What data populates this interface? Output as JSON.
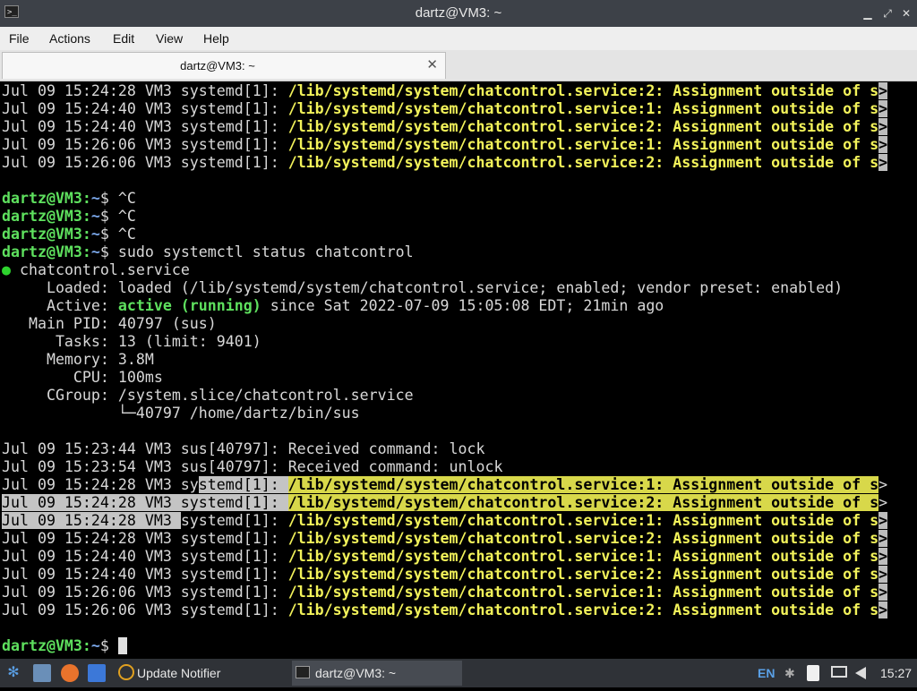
{
  "window": {
    "title": "dartz@VM3: ~",
    "controls": {
      "minimize": "▁",
      "maximize": "⤢",
      "close": "✕"
    }
  },
  "menu": [
    "File",
    "Actions",
    "Edit",
    "View",
    "Help"
  ],
  "tab": {
    "label": "dartz@VM3: ~",
    "close": "✕"
  },
  "terminal": {
    "lines": [
      [
        {
          "t": "Jul 09 15:24:28 VM3 systemd[1]: "
        },
        {
          "t": "/lib/systemd/system/chatcontrol.service:2: Assignment outside of s",
          "c": "yellow"
        },
        {
          "t": ">",
          "c": "trunc"
        }
      ],
      [
        {
          "t": "Jul 09 15:24:40 VM3 systemd[1]: "
        },
        {
          "t": "/lib/systemd/system/chatcontrol.service:1: Assignment outside of s",
          "c": "yellow"
        },
        {
          "t": ">",
          "c": "trunc"
        }
      ],
      [
        {
          "t": "Jul 09 15:24:40 VM3 systemd[1]: "
        },
        {
          "t": "/lib/systemd/system/chatcontrol.service:2: Assignment outside of s",
          "c": "yellow"
        },
        {
          "t": ">",
          "c": "trunc"
        }
      ],
      [
        {
          "t": "Jul 09 15:26:06 VM3 systemd[1]: "
        },
        {
          "t": "/lib/systemd/system/chatcontrol.service:1: Assignment outside of s",
          "c": "yellow"
        },
        {
          "t": ">",
          "c": "trunc"
        }
      ],
      [
        {
          "t": "Jul 09 15:26:06 VM3 systemd[1]: "
        },
        {
          "t": "/lib/systemd/system/chatcontrol.service:2: Assignment outside of s",
          "c": "yellow"
        },
        {
          "t": ">",
          "c": "trunc"
        }
      ],
      [],
      [
        {
          "t": "dartz@VM3:",
          "c": "green"
        },
        {
          "t": "~",
          "c": "blue"
        },
        {
          "t": "$ ^C"
        }
      ],
      [
        {
          "t": "dartz@VM3:",
          "c": "green"
        },
        {
          "t": "~",
          "c": "blue"
        },
        {
          "t": "$ ^C"
        }
      ],
      [
        {
          "t": "dartz@VM3:",
          "c": "green"
        },
        {
          "t": "~",
          "c": "blue"
        },
        {
          "t": "$ ^C"
        }
      ],
      [
        {
          "t": "dartz@VM3:",
          "c": "green"
        },
        {
          "t": "~",
          "c": "blue"
        },
        {
          "t": "$ sudo systemctl status chatcontrol"
        }
      ],
      [
        {
          "t": "●",
          "c": "dot"
        },
        {
          "t": " chatcontrol.service"
        }
      ],
      [
        {
          "t": "     Loaded: loaded (/lib/systemd/system/chatcontrol.service; enabled; vendor preset: enabled)"
        }
      ],
      [
        {
          "t": "     Active: "
        },
        {
          "t": "active (running)",
          "c": "green"
        },
        {
          "t": " since Sat 2022-07-09 15:05:08 EDT; 21min ago"
        }
      ],
      [
        {
          "t": "   Main PID: 40797 (sus)"
        }
      ],
      [
        {
          "t": "      Tasks: 13 (limit: 9401)"
        }
      ],
      [
        {
          "t": "     Memory: 3.8M"
        }
      ],
      [
        {
          "t": "        CPU: 100ms"
        }
      ],
      [
        {
          "t": "     CGroup: /system.slice/chatcontrol.service"
        }
      ],
      [
        {
          "t": "             └─40797 /home/dartz/bin/sus"
        }
      ],
      [],
      [
        {
          "t": "Jul 09 15:23:44 VM3 sus[40797]: Received command: lock"
        }
      ],
      [
        {
          "t": "Jul 09 15:23:54 VM3 sus[40797]: Received command: unlock"
        }
      ],
      [
        {
          "t": "Jul 09 15:24:28 VM3 sy"
        },
        {
          "t": "stemd[1]: ",
          "c": "hl-g"
        },
        {
          "t": "/lib/systemd/system/chatcontrol.service:1: Assignment outside of s",
          "c": "hl-y"
        },
        {
          "t": ">"
        }
      ],
      [
        {
          "t": "Jul 09 15:24:28 VM3 systemd[1]: ",
          "c": "hl-g"
        },
        {
          "t": "/lib/systemd/system/chatcontrol.service:2: Assignment outside of s",
          "c": "hl-y"
        },
        {
          "t": ">"
        }
      ],
      [
        {
          "t": "Jul 09 15:24:28 VM3 ",
          "c": "hl-g"
        },
        {
          "t": "systemd[1]: "
        },
        {
          "t": "/lib/systemd/system/chatcontrol.service:1: Assignment outside of s",
          "c": "yellow"
        },
        {
          "t": ">",
          "c": "trunc"
        }
      ],
      [
        {
          "t": "Jul 09 15:24:28 VM3 systemd[1]: "
        },
        {
          "t": "/lib/systemd/system/chatcontrol.service:2: Assignment outside of s",
          "c": "yellow"
        },
        {
          "t": ">",
          "c": "trunc"
        }
      ],
      [
        {
          "t": "Jul 09 15:24:40 VM3 systemd[1]: "
        },
        {
          "t": "/lib/systemd/system/chatcontrol.service:1: Assignment outside of s",
          "c": "yellow"
        },
        {
          "t": ">",
          "c": "trunc"
        }
      ],
      [
        {
          "t": "Jul 09 15:24:40 VM3 systemd[1]: "
        },
        {
          "t": "/lib/systemd/system/chatcontrol.service:2: Assignment outside of s",
          "c": "yellow"
        },
        {
          "t": ">",
          "c": "trunc"
        }
      ],
      [
        {
          "t": "Jul 09 15:26:06 VM3 systemd[1]: "
        },
        {
          "t": "/lib/systemd/system/chatcontrol.service:1: Assignment outside of s",
          "c": "yellow"
        },
        {
          "t": ">",
          "c": "trunc"
        }
      ],
      [
        {
          "t": "Jul 09 15:26:06 VM3 systemd[1]: "
        },
        {
          "t": "/lib/systemd/system/chatcontrol.service:2: Assignment outside of s",
          "c": "yellow"
        },
        {
          "t": ">",
          "c": "trunc"
        }
      ],
      [],
      [
        {
          "t": "dartz@VM3:",
          "c": "green"
        },
        {
          "t": "~",
          "c": "blue"
        },
        {
          "t": "$ "
        },
        {
          "t": " ",
          "c": "cursor"
        }
      ]
    ]
  },
  "taskbar": {
    "tasks": [
      {
        "label": "Update Notifier",
        "icon": "update-notifier-icon"
      },
      {
        "label": "dartz@VM3: ~",
        "icon": "terminal-icon"
      }
    ],
    "tray": {
      "language": "EN",
      "clock": "15:27"
    }
  },
  "colors": {
    "prompt_green": "#5ee05e",
    "path_blue": "#7aa6e8",
    "warning_yellow": "#f2f25a",
    "selection_yellow": "#d8d84a",
    "selection_gray": "#c4c4c4",
    "titlebar": "#3d4148",
    "taskbar": "#2f3237"
  }
}
